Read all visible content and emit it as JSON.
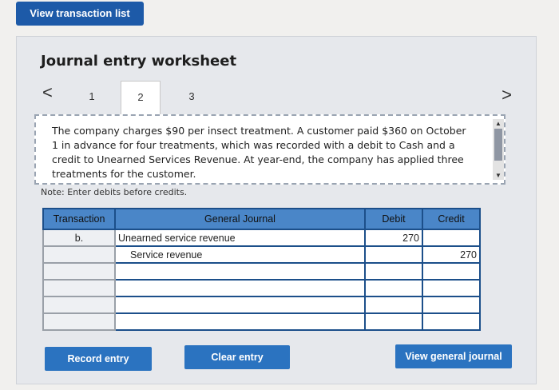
{
  "top_button": "View transaction list",
  "worksheet": {
    "title": "Journal entry worksheet",
    "prev_arrow": "<",
    "next_arrow": ">",
    "tabs": [
      "1",
      "2",
      "3"
    ],
    "description": "The company charges $90 per insect treatment. A customer paid $360 on October 1 in advance for four treatments, which was recorded with a debit to Cash and a credit to Unearned Services Revenue. At year-end, the company has applied three treatments for the customer.",
    "note": "Note: Enter debits before credits."
  },
  "journal": {
    "headers": [
      "Transaction",
      "General Journal",
      "Debit",
      "Credit"
    ],
    "rows": [
      {
        "transaction": "b.",
        "account": "Unearned service revenue",
        "debit": "270",
        "credit": ""
      },
      {
        "transaction": "",
        "account": "Service revenue",
        "debit": "",
        "credit": "270"
      },
      {
        "transaction": "",
        "account": "",
        "debit": "",
        "credit": ""
      },
      {
        "transaction": "",
        "account": "",
        "debit": "",
        "credit": ""
      },
      {
        "transaction": "",
        "account": "",
        "debit": "",
        "credit": ""
      },
      {
        "transaction": "",
        "account": "",
        "debit": "",
        "credit": ""
      }
    ]
  },
  "buttons": {
    "record": "Record entry",
    "clear": "Clear entry",
    "general": "View general journal"
  },
  "colors": {
    "header_blue": "#4a86c8",
    "button_blue": "#2b73c0",
    "top_button_blue": "#1d5aa8"
  }
}
